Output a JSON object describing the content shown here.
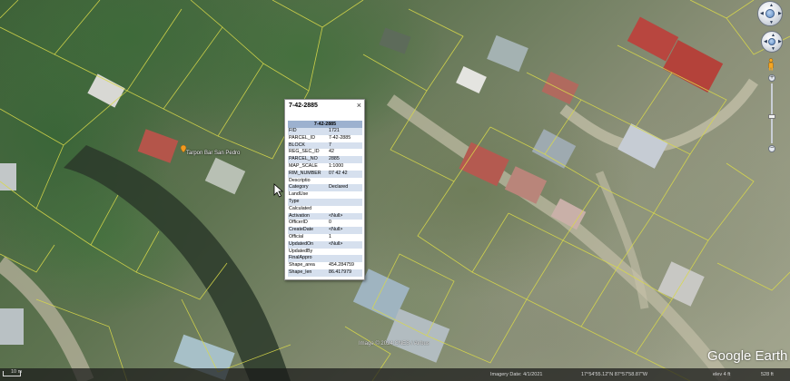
{
  "popup": {
    "title": "7-42-2885",
    "table_header": "7-42-2885",
    "close_glyph": "×",
    "rows": [
      {
        "key": "FID",
        "value": "1721"
      },
      {
        "key": "PARCEL_ID",
        "value": "7-42-2885"
      },
      {
        "key": "BLOCK",
        "value": "7"
      },
      {
        "key": "REG_SEC_ID",
        "value": "42"
      },
      {
        "key": "PARCEL_NO",
        "value": "2885"
      },
      {
        "key": "MAP_SCALE",
        "value": "1:1000"
      },
      {
        "key": "RIM_NUMBER",
        "value": "07 42 42"
      },
      {
        "key": "Descriptio",
        "value": ""
      },
      {
        "key": "Category",
        "value": "Declared"
      },
      {
        "key": "LandUse",
        "value": ""
      },
      {
        "key": "Type",
        "value": ""
      },
      {
        "key": "Calculated",
        "value": ""
      },
      {
        "key": "Activation",
        "value": "<Null>"
      },
      {
        "key": "OfficerID",
        "value": "0"
      },
      {
        "key": "CreateDate",
        "value": "<Null>"
      },
      {
        "key": "Official",
        "value": "1"
      },
      {
        "key": "UpdatedOn",
        "value": "<Null>"
      },
      {
        "key": "UpdatedBy",
        "value": ""
      },
      {
        "key": "FinalAppro",
        "value": ""
      },
      {
        "key": "Shape_area",
        "value": "454.284759"
      },
      {
        "key": "Shape_len",
        "value": "86.417979"
      }
    ]
  },
  "map": {
    "place_label": "Tarpon Bar San Pedro",
    "imagery_credit": "Image © 2024 CNES / Airbus",
    "logo": "Google Earth",
    "parcel_line_color": "#d9d94a"
  },
  "statusbar": {
    "scale": "10 m",
    "imagery_date": "Imagery Date: 4/1/2021",
    "coordinates": "17°54'55.12\"N  87°57'58.87\"W",
    "elevation": "elev 4 ft",
    "eye_alt": "528 ft"
  },
  "icons": {
    "look": "look-around-icon",
    "move": "move-icon",
    "pegman": "street-view-pegman-icon",
    "pin": "placemark-pin-icon",
    "cursor": "mouse-pointer-icon"
  }
}
